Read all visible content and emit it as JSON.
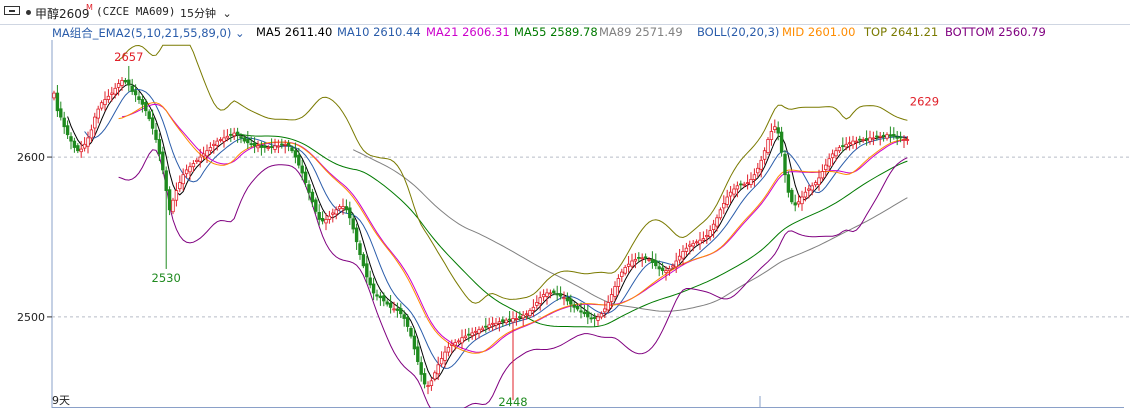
{
  "header": {
    "title": "甲醇2609",
    "title_superscript": "M",
    "contract": "(CZCE MA609)",
    "period": "15分钟"
  },
  "indicators": {
    "group_label": "MA组合_EMA2(5,10,21,55,89,0)",
    "items": [
      {
        "label": "MA5 2611.40",
        "color": "#000000"
      },
      {
        "label": "MA10 2610.44",
        "color": "#2a5caa"
      },
      {
        "label": "MA21 2606.31",
        "color": "#cc00cc"
      },
      {
        "label": "MA55 2589.78",
        "color": "#007a00"
      },
      {
        "label": "MA89 2571.49",
        "color": "#808080"
      },
      {
        "label": "BOLL(20,20,3)",
        "color": "#2a5caa"
      },
      {
        "label": "MID 2601.00",
        "color": "#ff8c00"
      },
      {
        "label": "TOP 2641.21",
        "color": "#7a7a00"
      },
      {
        "label": "BOTTOM 2560.79",
        "color": "#800080"
      }
    ]
  },
  "footer": {
    "date_label": "9天"
  },
  "colors": {
    "up": "#e0202a",
    "down": "#1f8a1f",
    "ma5": "#000000",
    "ma10": "#2a5caa",
    "ma21": "#cc00cc",
    "ma55": "#007a00",
    "ma89": "#808080",
    "mid": "#ff8c00",
    "top": "#7a7a00",
    "bottom": "#800080"
  },
  "chart_data": {
    "type": "candlestick",
    "y_ticks": [
      2600,
      2500
    ],
    "ylim": [
      2443,
      2672
    ],
    "grid": "horizontal dashed at 2600 and 2500",
    "annotations": [
      {
        "text": "2657",
        "index": 22,
        "value": 2657,
        "kind": "high"
      },
      {
        "text": "2530",
        "index": 33,
        "value": 2530,
        "kind": "low"
      },
      {
        "text": "2448",
        "index": 135,
        "value": 2448,
        "kind": "low"
      },
      {
        "text": "2629",
        "index": 256,
        "value": 2629,
        "kind": "high"
      }
    ],
    "closes": [
      2640,
      2629,
      2625,
      2619,
      2614,
      2610,
      2606,
      2604,
      2605,
      2608,
      2612,
      2617,
      2625,
      2630,
      2634,
      2636,
      2638,
      2640,
      2643,
      2646,
      2648,
      2647,
      2645,
      2641,
      2639,
      2636,
      2633,
      2629,
      2624,
      2618,
      2611,
      2602,
      2592,
      2579,
      2567,
      2573,
      2579,
      2584,
      2589,
      2592,
      2594,
      2596,
      2598,
      2600,
      2602,
      2604,
      2606,
      2608,
      2610,
      2611,
      2612,
      2613,
      2614,
      2615,
      2614,
      2612,
      2610,
      2609,
      2608,
      2607,
      2607,
      2606,
      2606,
      2606,
      2606,
      2607,
      2607,
      2608,
      2608,
      2607,
      2604,
      2600,
      2595,
      2590,
      2584,
      2578,
      2572,
      2566,
      2561,
      2560,
      2561,
      2563,
      2565,
      2567,
      2569,
      2569,
      2567,
      2562,
      2555,
      2547,
      2539,
      2532,
      2525,
      2520,
      2515,
      2513,
      2512,
      2510,
      2508,
      2506,
      2505,
      2504,
      2502,
      2499,
      2494,
      2488,
      2480,
      2472,
      2464,
      2458,
      2457,
      2460,
      2465,
      2470,
      2474,
      2478,
      2481,
      2483,
      2484,
      2485,
      2487,
      2488,
      2489,
      2490,
      2491,
      2492,
      2493,
      2494,
      2495,
      2496,
      2496,
      2497,
      2497,
      2498,
      2498,
      2499,
      2499,
      2500,
      2501,
      2502,
      2504,
      2506,
      2509,
      2512,
      2514,
      2515,
      2515,
      2515,
      2514,
      2513,
      2512,
      2510,
      2508,
      2506,
      2505,
      2503,
      2502,
      2500,
      2499,
      2499,
      2500,
      2502,
      2505,
      2509,
      2514,
      2519,
      2524,
      2528,
      2531,
      2533,
      2535,
      2536,
      2537,
      2537,
      2537,
      2536,
      2534,
      2532,
      2530,
      2529,
      2529,
      2530,
      2532,
      2535,
      2538,
      2541,
      2543,
      2545,
      2546,
      2547,
      2548,
      2549,
      2551,
      2554,
      2558,
      2562,
      2567,
      2571,
      2575,
      2578,
      2580,
      2582,
      2583,
      2583,
      2584,
      2586,
      2589,
      2593,
      2598,
      2604,
      2611,
      2616,
      2619,
      2615,
      2603,
      2589,
      2578,
      2572,
      2570,
      2572,
      2575,
      2578,
      2580,
      2582,
      2584,
      2587,
      2591,
      2595,
      2599,
      2602,
      2604,
      2606,
      2607,
      2608,
      2609,
      2610,
      2610,
      2611,
      2611,
      2611,
      2612,
      2612,
      2613,
      2613,
      2613,
      2614,
      2613,
      2613,
      2612,
      2612,
      2611,
      2611
    ],
    "series": [
      {
        "name": "MA5",
        "period": 5,
        "color": "#000000"
      },
      {
        "name": "MA10",
        "period": 10,
        "color": "#2a5caa"
      },
      {
        "name": "MA21",
        "period": 21,
        "color": "#cc00cc"
      },
      {
        "name": "MA55",
        "period": 55,
        "color": "#007a00"
      },
      {
        "name": "MA89",
        "period": 89,
        "color": "#808080"
      },
      {
        "name": "MID",
        "period": 20,
        "color": "#ff8c00"
      },
      {
        "name": "TOP",
        "period": 20,
        "color": "#7a7a00"
      },
      {
        "name": "BOTTOM",
        "period": 20,
        "color": "#800080"
      }
    ]
  }
}
